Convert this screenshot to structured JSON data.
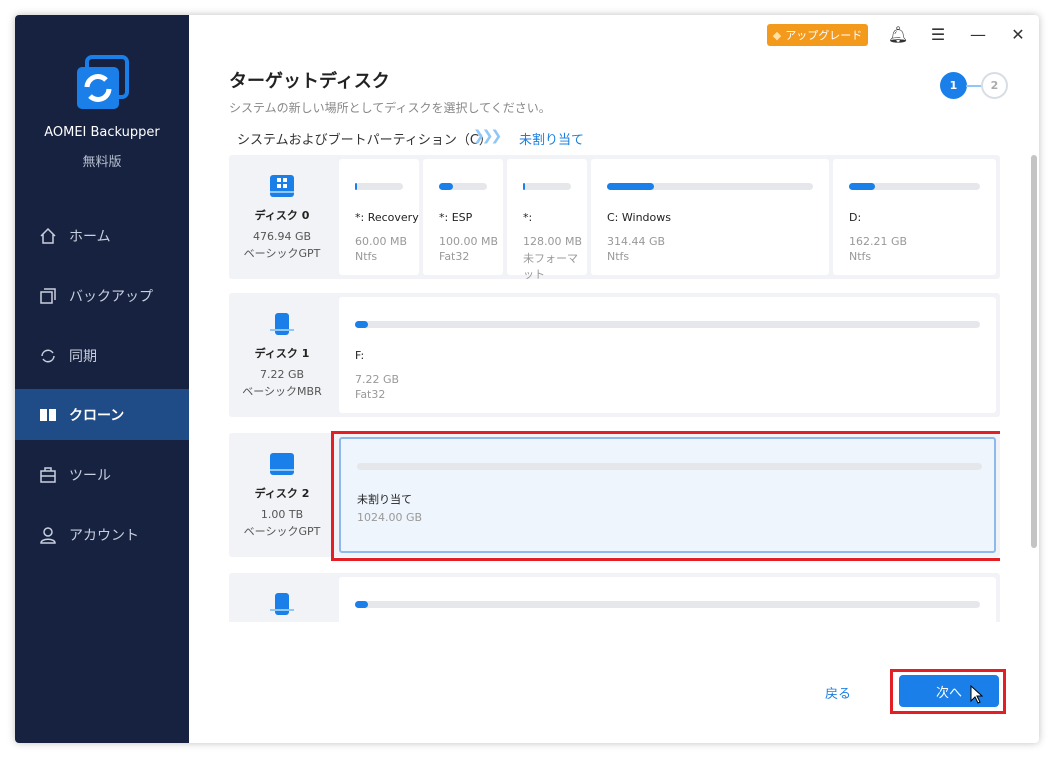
{
  "app": {
    "name": "AOMEI Backupper",
    "edition": "無料版"
  },
  "nav": [
    {
      "label": "ホーム"
    },
    {
      "label": "バックアップ"
    },
    {
      "label": "同期"
    },
    {
      "label": "クローン"
    },
    {
      "label": "ツール"
    },
    {
      "label": "アカウント"
    }
  ],
  "header": {
    "upgrade": "アップグレード",
    "title": "ターゲットディスク",
    "subtitle": "システムの新しい場所としてディスクを選択してください。",
    "step1": "1",
    "step2": "2"
  },
  "legend": {
    "system": "システムおよびブートパーティション（C）",
    "unallocated": "未割り当て"
  },
  "disks": [
    {
      "name": "ディスク 0",
      "size": "476.94 GB",
      "type": "ベーシックGPT",
      "partitions": [
        {
          "name": "*: Recovery",
          "size": "60.00 MB",
          "fs": "Ntfs",
          "used": 0.05
        },
        {
          "name": "*: ESP",
          "size": "100.00 MB",
          "fs": "Fat32",
          "used": 0.3
        },
        {
          "name": "*:",
          "size": "128.00 MB",
          "fs": "未フォーマット",
          "used": 0.05
        },
        {
          "name": "C: Windows",
          "size": "314.44 GB",
          "fs": "Ntfs",
          "used": 0.23
        },
        {
          "name": "D:",
          "size": "162.21 GB",
          "fs": "Ntfs",
          "used": 0.2
        }
      ]
    },
    {
      "name": "ディスク 1",
      "size": "7.22 GB",
      "type": "ベーシックMBR",
      "partitions": [
        {
          "name": "F:",
          "size": "7.22 GB",
          "fs": "Fat32",
          "used": 0.01
        }
      ]
    },
    {
      "name": "ディスク 2",
      "size": "1.00 TB",
      "type": "ベーシックGPT",
      "partitions": [
        {
          "name": "未割り当て",
          "size": "1024.00 GB",
          "used": 0
        }
      ]
    },
    {
      "partitions": [
        {
          "used": 0.01
        }
      ]
    }
  ],
  "footer": {
    "back": "戻る",
    "next": "次へ"
  }
}
